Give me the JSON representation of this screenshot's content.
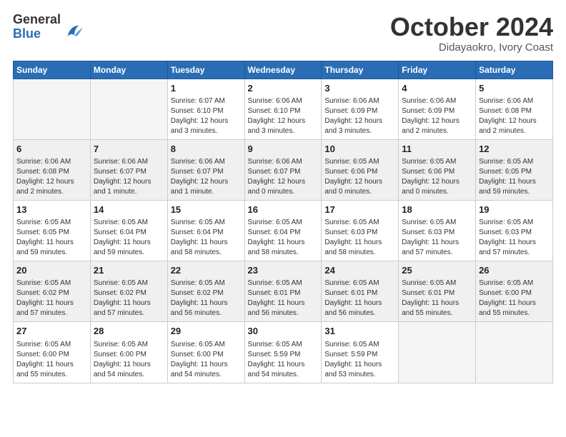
{
  "logo": {
    "general": "General",
    "blue": "Blue"
  },
  "title": "October 2024",
  "location": "Didayaokro, Ivory Coast",
  "weekdays": [
    "Sunday",
    "Monday",
    "Tuesday",
    "Wednesday",
    "Thursday",
    "Friday",
    "Saturday"
  ],
  "weeks": [
    [
      {
        "day": "",
        "info": ""
      },
      {
        "day": "",
        "info": ""
      },
      {
        "day": "1",
        "info": "Sunrise: 6:07 AM\nSunset: 6:10 PM\nDaylight: 12 hours and 3 minutes."
      },
      {
        "day": "2",
        "info": "Sunrise: 6:06 AM\nSunset: 6:10 PM\nDaylight: 12 hours and 3 minutes."
      },
      {
        "day": "3",
        "info": "Sunrise: 6:06 AM\nSunset: 6:09 PM\nDaylight: 12 hours and 3 minutes."
      },
      {
        "day": "4",
        "info": "Sunrise: 6:06 AM\nSunset: 6:09 PM\nDaylight: 12 hours and 2 minutes."
      },
      {
        "day": "5",
        "info": "Sunrise: 6:06 AM\nSunset: 6:08 PM\nDaylight: 12 hours and 2 minutes."
      }
    ],
    [
      {
        "day": "6",
        "info": "Sunrise: 6:06 AM\nSunset: 6:08 PM\nDaylight: 12 hours and 2 minutes."
      },
      {
        "day": "7",
        "info": "Sunrise: 6:06 AM\nSunset: 6:07 PM\nDaylight: 12 hours and 1 minute."
      },
      {
        "day": "8",
        "info": "Sunrise: 6:06 AM\nSunset: 6:07 PM\nDaylight: 12 hours and 1 minute."
      },
      {
        "day": "9",
        "info": "Sunrise: 6:06 AM\nSunset: 6:07 PM\nDaylight: 12 hours and 0 minutes."
      },
      {
        "day": "10",
        "info": "Sunrise: 6:05 AM\nSunset: 6:06 PM\nDaylight: 12 hours and 0 minutes."
      },
      {
        "day": "11",
        "info": "Sunrise: 6:05 AM\nSunset: 6:06 PM\nDaylight: 12 hours and 0 minutes."
      },
      {
        "day": "12",
        "info": "Sunrise: 6:05 AM\nSunset: 6:05 PM\nDaylight: 11 hours and 59 minutes."
      }
    ],
    [
      {
        "day": "13",
        "info": "Sunrise: 6:05 AM\nSunset: 6:05 PM\nDaylight: 11 hours and 59 minutes."
      },
      {
        "day": "14",
        "info": "Sunrise: 6:05 AM\nSunset: 6:04 PM\nDaylight: 11 hours and 59 minutes."
      },
      {
        "day": "15",
        "info": "Sunrise: 6:05 AM\nSunset: 6:04 PM\nDaylight: 11 hours and 58 minutes."
      },
      {
        "day": "16",
        "info": "Sunrise: 6:05 AM\nSunset: 6:04 PM\nDaylight: 11 hours and 58 minutes."
      },
      {
        "day": "17",
        "info": "Sunrise: 6:05 AM\nSunset: 6:03 PM\nDaylight: 11 hours and 58 minutes."
      },
      {
        "day": "18",
        "info": "Sunrise: 6:05 AM\nSunset: 6:03 PM\nDaylight: 11 hours and 57 minutes."
      },
      {
        "day": "19",
        "info": "Sunrise: 6:05 AM\nSunset: 6:03 PM\nDaylight: 11 hours and 57 minutes."
      }
    ],
    [
      {
        "day": "20",
        "info": "Sunrise: 6:05 AM\nSunset: 6:02 PM\nDaylight: 11 hours and 57 minutes."
      },
      {
        "day": "21",
        "info": "Sunrise: 6:05 AM\nSunset: 6:02 PM\nDaylight: 11 hours and 57 minutes."
      },
      {
        "day": "22",
        "info": "Sunrise: 6:05 AM\nSunset: 6:02 PM\nDaylight: 11 hours and 56 minutes."
      },
      {
        "day": "23",
        "info": "Sunrise: 6:05 AM\nSunset: 6:01 PM\nDaylight: 11 hours and 56 minutes."
      },
      {
        "day": "24",
        "info": "Sunrise: 6:05 AM\nSunset: 6:01 PM\nDaylight: 11 hours and 56 minutes."
      },
      {
        "day": "25",
        "info": "Sunrise: 6:05 AM\nSunset: 6:01 PM\nDaylight: 11 hours and 55 minutes."
      },
      {
        "day": "26",
        "info": "Sunrise: 6:05 AM\nSunset: 6:00 PM\nDaylight: 11 hours and 55 minutes."
      }
    ],
    [
      {
        "day": "27",
        "info": "Sunrise: 6:05 AM\nSunset: 6:00 PM\nDaylight: 11 hours and 55 minutes."
      },
      {
        "day": "28",
        "info": "Sunrise: 6:05 AM\nSunset: 6:00 PM\nDaylight: 11 hours and 54 minutes."
      },
      {
        "day": "29",
        "info": "Sunrise: 6:05 AM\nSunset: 6:00 PM\nDaylight: 11 hours and 54 minutes."
      },
      {
        "day": "30",
        "info": "Sunrise: 6:05 AM\nSunset: 5:59 PM\nDaylight: 11 hours and 54 minutes."
      },
      {
        "day": "31",
        "info": "Sunrise: 6:05 AM\nSunset: 5:59 PM\nDaylight: 11 hours and 53 minutes."
      },
      {
        "day": "",
        "info": ""
      },
      {
        "day": "",
        "info": ""
      }
    ]
  ]
}
